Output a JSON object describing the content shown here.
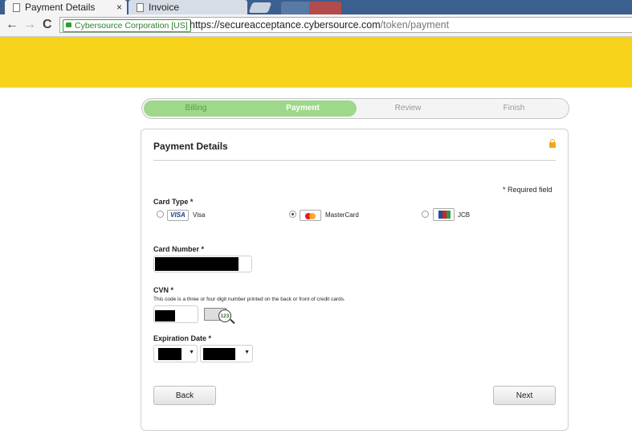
{
  "browser": {
    "tabs": [
      {
        "label": "Payment Details",
        "close": "×"
      },
      {
        "label": "Invoice"
      }
    ],
    "nav": {
      "back": "←",
      "forward": "→",
      "reload": "C"
    },
    "ev_badge": "Cybersource Corporation [US]",
    "url_host": "https://secureacceptance.cybersource.com",
    "url_path": "/token/payment"
  },
  "progress": {
    "steps": [
      "Billing",
      "Payment",
      "Review",
      "Finish"
    ],
    "current_step": "Payment",
    "colors": {
      "done": "#9ed88a",
      "current_text": "#ffffff",
      "pending_text": "#999999"
    }
  },
  "form": {
    "title": "Payment Details",
    "required_note": "* Required field",
    "card_type_label": "Card Type *",
    "card_types": [
      {
        "name": "Visa",
        "logo_text": "VISA",
        "selected": false
      },
      {
        "name": "MasterCard",
        "selected": true
      },
      {
        "name": "JCB",
        "selected": false
      }
    ],
    "card_number_label": "Card Number *",
    "cvn_label": "CVN *",
    "cvn_hint": "This code is a three or four digit number printed on the back or front of credit cards.",
    "cvn_image_text": "123",
    "expiration_label": "Expiration Date *",
    "select_arrow": "▼",
    "back_button": "Back",
    "next_button": "Next"
  },
  "colors": {
    "banner": "#f7d21a",
    "accent_green": "#9ed88a",
    "lock": "#f0a81a"
  }
}
